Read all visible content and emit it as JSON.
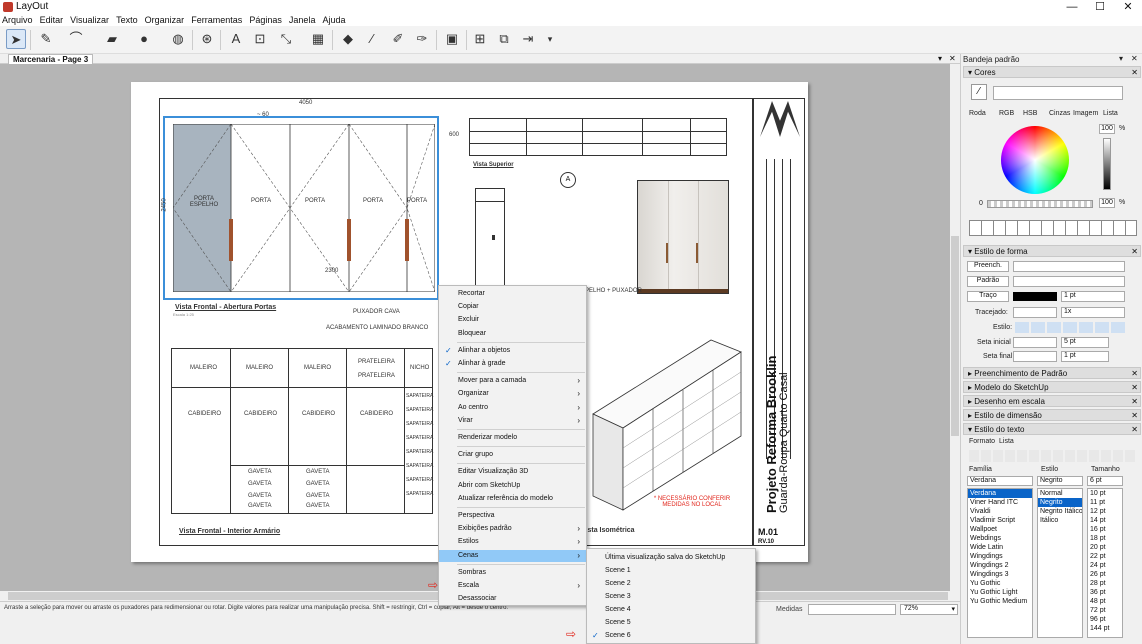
{
  "window": {
    "title": "LayOut",
    "minimize": "—",
    "maximize": "☐",
    "close": "✕"
  },
  "menus": [
    "Arquivo",
    "Editar",
    "Visualizar",
    "Texto",
    "Organizar",
    "Ferramentas",
    "Páginas",
    "Janela",
    "Ajuda"
  ],
  "toolbar": {
    "icons": [
      "select-icon",
      "pencil-icon",
      "line-icon",
      "shape-icon",
      "circle-icon",
      "paint-icon",
      "text-icon",
      "label-icon",
      "dimension-icon",
      "table-icon",
      "eraser-icon",
      "eyedropper-icon",
      "style-icon",
      "split-icon",
      "present-icon",
      "add-page-icon",
      "duplicate-page-icon",
      "next-page-icon"
    ]
  },
  "document": {
    "tab": "Marcenaria - Page 3"
  },
  "drawing": {
    "dim_top": "4050",
    "dim_sub": "~ 60",
    "dim_left": "2450",
    "dim_right": "600",
    "doors": [
      "PORTA ESPELHO",
      "PORTA",
      "PORTA",
      "PORTA",
      "PORTA"
    ],
    "dim_inner": "2300",
    "puxador": "PUXADOR CAVA",
    "acabamento": "ACABAMENTO LAMINADO BRANCO",
    "title_front": "Vista Frontal - Abertura Portas",
    "title_top": "Vista Superior",
    "title_interior": "Vista Frontal - Interior Armário",
    "title_iso": "Vista Isométrica",
    "scale": "Escala 1:25",
    "section_marker": "A",
    "espelho_label": "ESPELHO + PUXADOR",
    "malerio": [
      "MALEIRO",
      "MALEIRO",
      "MALEIRO"
    ],
    "prateleira": [
      "PRATELEIRA",
      "PRATELEIRA"
    ],
    "nicho": "NICHO",
    "cabideiro": [
      "CABIDEIRO",
      "CABIDEIRO",
      "CABIDEIRO",
      "CABIDEIRO"
    ],
    "sapateira": [
      "SAPATEIRA",
      "SAPATEIRA",
      "SAPATEIRA",
      "SAPATEIRA",
      "SAPATEIRA",
      "SAPATEIRA",
      "SAPATEIRA",
      "SAPATEIRA"
    ],
    "gaveta": [
      "GAVETA",
      "GAVETA",
      "GAVETA",
      "GAVETA",
      "GAVETA",
      "GAVETA",
      "GAVETA",
      "GAVETA"
    ],
    "note": "* NECESSÁRIO CONFERIR MEDIDAS NO LOCAL",
    "project_title": "Projeto Reforma Brooklin",
    "project_sub": "Guarda-Roupa Quarto Casal",
    "sheet": "M.01",
    "revision": "RV.10"
  },
  "context_menu": [
    {
      "label": "Recortar"
    },
    {
      "label": "Copiar"
    },
    {
      "label": "Excluir"
    },
    {
      "label": "Bloquear"
    },
    {
      "label": "Alinhar a objetos",
      "checked": true
    },
    {
      "label": "Alinhar à grade",
      "checked": true
    },
    {
      "label": "Mover para a camada",
      "sub": true
    },
    {
      "label": "Organizar",
      "sub": true
    },
    {
      "label": "Ao centro",
      "sub": true
    },
    {
      "label": "Virar",
      "sub": true
    },
    {
      "label": "Renderizar modelo"
    },
    {
      "label": "Criar grupo"
    },
    {
      "label": "Editar Visualização 3D"
    },
    {
      "label": "Abrir com SketchUp"
    },
    {
      "label": "Atualizar referência do modelo"
    },
    {
      "label": "Perspectiva"
    },
    {
      "label": "Exibições padrão",
      "sub": true
    },
    {
      "label": "Estilos",
      "sub": true
    },
    {
      "label": "Cenas",
      "sub": true,
      "highlight": true
    },
    {
      "label": "Sombras"
    },
    {
      "label": "Escala",
      "sub": true
    },
    {
      "label": "Desassociar"
    }
  ],
  "submenu": [
    {
      "label": "Última visualização salva do SketchUp"
    },
    {
      "label": "Scene 1"
    },
    {
      "label": "Scene 2"
    },
    {
      "label": "Scene 3"
    },
    {
      "label": "Scene 4"
    },
    {
      "label": "Scene 5"
    },
    {
      "label": "Scene 6",
      "checked": true
    }
  ],
  "status": {
    "hint": "Arraste a seleção para mover ou arraste os puxadores para redimensionar ou rotar. Digite valores para realizar uma manipulação precisa. Shift = restringir, Ctrl = copiar, Alt = desde o centro.",
    "measures_label": "Medidas",
    "zoom": "72%"
  },
  "tray": {
    "title": "Bandeja padrão",
    "sections": {
      "cores": "Cores",
      "estilo_forma": "Estilo de forma",
      "preenchimento": "Preenchimento de Padrão",
      "modelo": "Modelo do SketchUp",
      "desenho": "Desenho em escala",
      "dimensao": "Estilo de dimensão",
      "texto": "Estilo do texto"
    },
    "color_tabs": [
      "Roda",
      "RGB",
      "HSB",
      "Cinzas",
      "Imagem",
      "Lista"
    ],
    "brightness": "100",
    "opacity": "100",
    "opacity_min": "0",
    "pct": "%",
    "shape": {
      "fill": "Preench.",
      "pattern": "Padrão",
      "stroke": "Traço",
      "stroke_val": "1 pt",
      "dash": "Tracejado:",
      "dash_val": "1x",
      "style": "Estilo:",
      "start_arrow": "Seta inicial",
      "start_val": "5 pt",
      "end_arrow": "Seta final",
      "end_val": "1 pt"
    },
    "text_tabs": [
      "Formato",
      "Lista"
    ],
    "family_label": "Família",
    "style_label": "Estilo",
    "size_label": "Tamanho",
    "family_val": "Verdana",
    "style_val": "Negrito",
    "size_val": "6 pt",
    "families": [
      "Verdana",
      "Viner Hand ITC",
      "Vivaldi",
      "Vladimir Script",
      "Wallpoet",
      "Webdings",
      "Wide Latin",
      "Wingdings",
      "Wingdings 2",
      "Wingdings 3",
      "Yu Gothic",
      "Yu Gothic Light",
      "Yu Gothic Medium"
    ],
    "styles": [
      "Normal",
      "Negrito",
      "Negrito Itálico",
      "Itálico"
    ],
    "sizes": [
      "10 pt",
      "11 pt",
      "12 pt",
      "14 pt",
      "16 pt",
      "18 pt",
      "20 pt",
      "22 pt",
      "24 pt",
      "26 pt",
      "28 pt",
      "36 pt",
      "48 pt",
      "72 pt",
      "96 pt",
      "144 pt"
    ]
  }
}
